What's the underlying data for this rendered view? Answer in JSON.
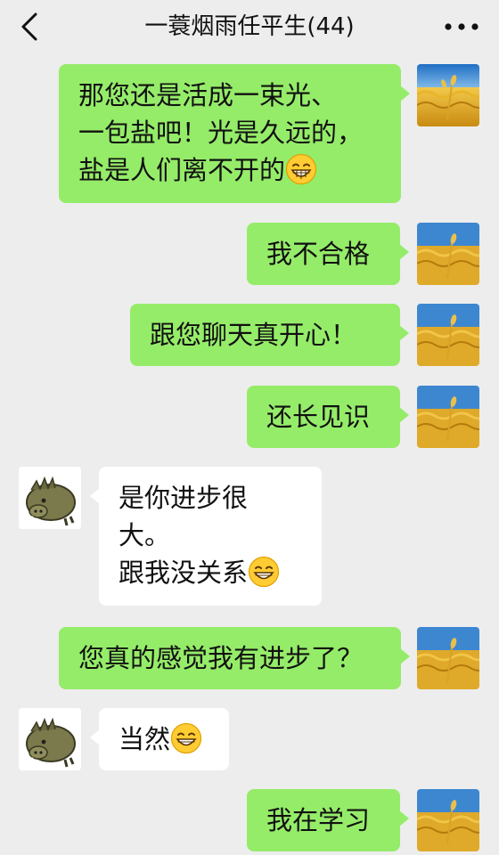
{
  "header": {
    "title": "一蓑烟雨任平生(44)",
    "back_icon": "chevron-left-icon",
    "more_icon": "more-dots-icon"
  },
  "colors": {
    "background": "#ededed",
    "self_bubble": "#95ec69",
    "other_bubble": "#ffffff"
  },
  "messages": [
    {
      "from": "self",
      "lines": [
        "那您还是活成一束光、",
        "一包盐吧！光是久远的，",
        "盐是人们离不开的"
      ],
      "emoji": "grin-emoji-icon"
    },
    {
      "from": "self",
      "lines": [
        "我不合格"
      ]
    },
    {
      "from": "self",
      "lines": [
        "跟您聊天真开心！"
      ]
    },
    {
      "from": "self",
      "lines": [
        "还长见识"
      ]
    },
    {
      "from": "other",
      "lines": [
        "是你进步很",
        "大。",
        "跟我没关系"
      ],
      "emoji": "smile-emoji-icon"
    },
    {
      "from": "self",
      "lines": [
        "您真的感觉我有进步了？"
      ]
    },
    {
      "from": "other",
      "lines": [
        "当然"
      ],
      "emoji": "smile-emoji-icon"
    },
    {
      "from": "self",
      "lines": [
        "我在学习"
      ]
    }
  ]
}
